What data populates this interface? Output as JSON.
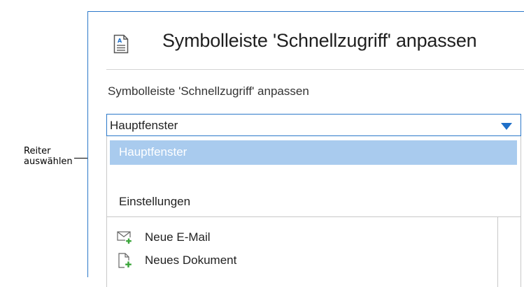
{
  "callout": {
    "line1": "Reiter",
    "line2": "auswählen"
  },
  "dialog": {
    "title": "Symbolleiste 'Schnellzugriff' anpassen",
    "icon": "document-icon",
    "section_label": "Symbolleiste 'Schnellzugriff' anpassen",
    "dropdown": {
      "selected": "Hauptfenster",
      "options": [
        {
          "label": "Hauptfenster",
          "highlighted": true
        },
        {
          "label": "Einstellungen",
          "highlighted": false
        }
      ]
    },
    "commands": [
      {
        "label": "Neue E-Mail",
        "icon": "new-email-icon"
      },
      {
        "label": "Neues Dokument",
        "icon": "new-document-icon"
      }
    ]
  },
  "colors": {
    "accent_border": "#2b78c9",
    "highlight": "#a9cbee",
    "add_badge": "#3aa53a"
  }
}
